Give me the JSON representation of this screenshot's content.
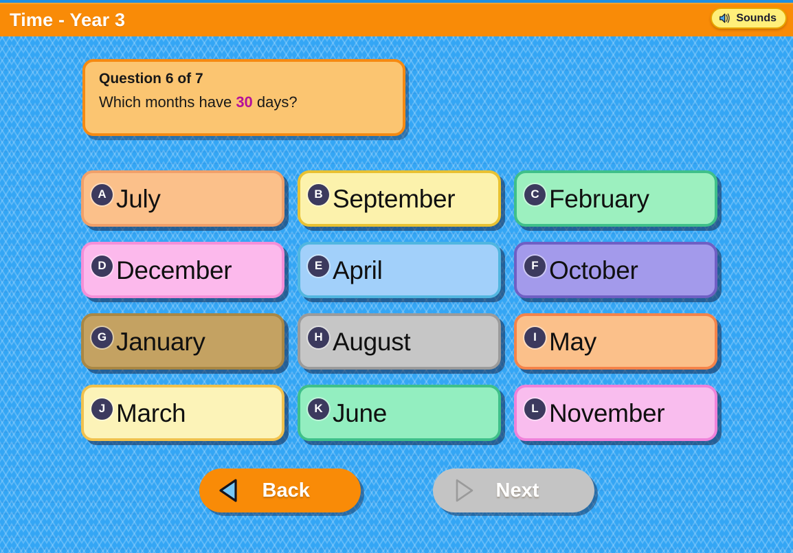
{
  "header": {
    "title": "Time - Year 3",
    "accent_color": "#f98b07",
    "sounds_button": {
      "label": "Sounds",
      "icon": "speaker-icon",
      "background_color": "#ffef7a"
    }
  },
  "background": {
    "color": "#34a6f5",
    "pattern": "chevron-zigzag"
  },
  "question": {
    "counter_label": "Question 6 of 7",
    "current": 6,
    "total": 7,
    "text_before": "Which months have ",
    "highlight": "30",
    "text_after": " days?",
    "highlight_color": "#b5109a",
    "panel_color": "#fbc571",
    "panel_border_color": "#f58a12"
  },
  "answers": [
    {
      "letter": "A",
      "label": "July",
      "fill": "#fbc08a",
      "border": "#f0a06a"
    },
    {
      "letter": "B",
      "label": "September",
      "fill": "#fcf2ac",
      "border": "#e8c132"
    },
    {
      "letter": "C",
      "label": "February",
      "fill": "#9cf0bf",
      "border": "#3fc08a"
    },
    {
      "letter": "D",
      "label": "December",
      "fill": "#fcb9ec",
      "border": "#f48fd8"
    },
    {
      "letter": "E",
      "label": "April",
      "fill": "#a2d0fa",
      "border": "#51b6e0"
    },
    {
      "letter": "F",
      "label": "October",
      "fill": "#a39aeb",
      "border": "#6f5fc4"
    },
    {
      "letter": "G",
      "label": "January",
      "fill": "#c4a262",
      "border": "#a98744"
    },
    {
      "letter": "H",
      "label": "August",
      "fill": "#c6c6c6",
      "border": "#9b9b9b"
    },
    {
      "letter": "I",
      "label": "May",
      "fill": "#fbc08a",
      "border": "#f4834a"
    },
    {
      "letter": "J",
      "label": "March",
      "fill": "#fcf3b8",
      "border": "#f0c14d"
    },
    {
      "letter": "K",
      "label": "June",
      "fill": "#93eec0",
      "border": "#3fc08a"
    },
    {
      "letter": "L",
      "label": "November",
      "fill": "#f9bdee",
      "border": "#ef82da"
    }
  ],
  "nav": {
    "back": {
      "label": "Back",
      "icon": "triangle-left-icon",
      "enabled": true,
      "color": "#f98b07"
    },
    "next": {
      "label": "Next",
      "icon": "triangle-right-icon",
      "enabled": false,
      "color": "#c4c4c4"
    }
  }
}
